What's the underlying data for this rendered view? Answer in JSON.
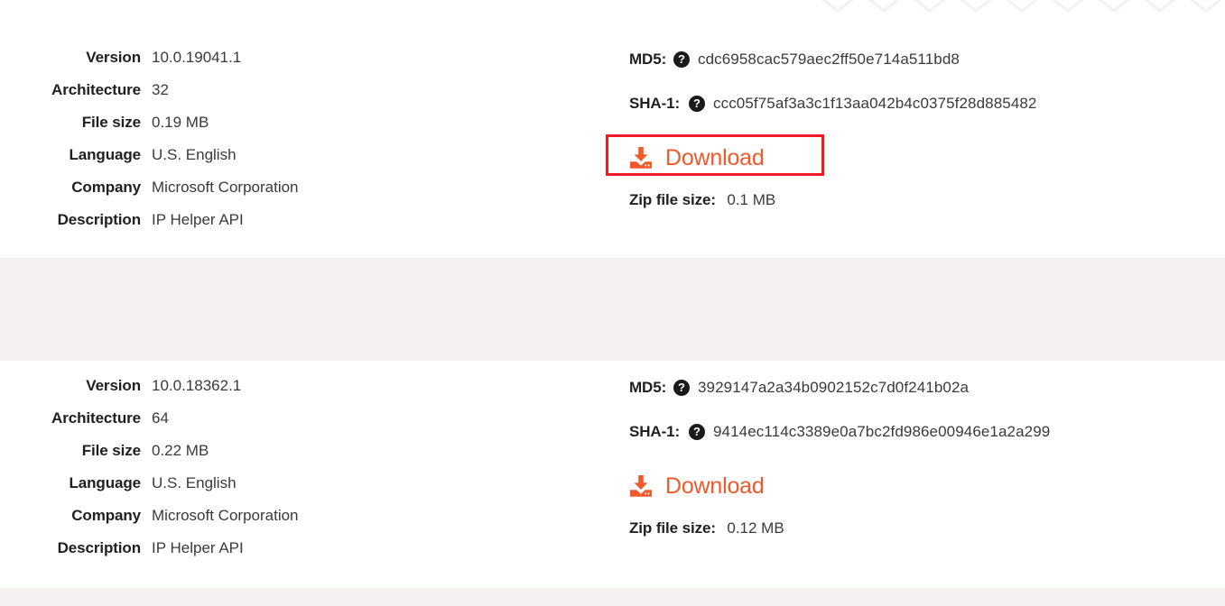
{
  "page": {
    "spec_labels": {
      "version": "Version",
      "architecture": "Architecture",
      "file_size": "File size",
      "language": "Language",
      "company": "Company",
      "description": "Description"
    },
    "hash_labels": {
      "md5": "MD5:",
      "sha1": "SHA-1:"
    },
    "help_icon_glyph": "?",
    "download_label": "Download",
    "zip_label": "Zip file size:",
    "colors": {
      "download_orange": "#f2592a",
      "highlight_red": "#ed1c24",
      "band_gray": "#f4f1f0",
      "text_dark": "#1f1f1f"
    }
  },
  "entries": [
    {
      "version": "10.0.19041.1",
      "architecture": "32",
      "file_size": "0.19 MB",
      "language": "U.S. English",
      "company": "Microsoft Corporation",
      "description": "IP Helper API",
      "md5": "cdc6958cac579aec2ff50e714a511bd8",
      "sha1": "ccc05f75af3a3c1f13aa042b4c0375f28d885482",
      "zip_file_size": "0.1 MB",
      "highlighted": true
    },
    {
      "version": "10.0.18362.1",
      "architecture": "64",
      "file_size": "0.22 MB",
      "language": "U.S. English",
      "company": "Microsoft Corporation",
      "description": "IP Helper API",
      "md5": "3929147a2a34b0902152c7d0f241b02a",
      "sha1": "9414ec114c3389e0a7bc2fd986e00946e1a2a299",
      "zip_file_size": "0.12 MB",
      "highlighted": false
    }
  ]
}
